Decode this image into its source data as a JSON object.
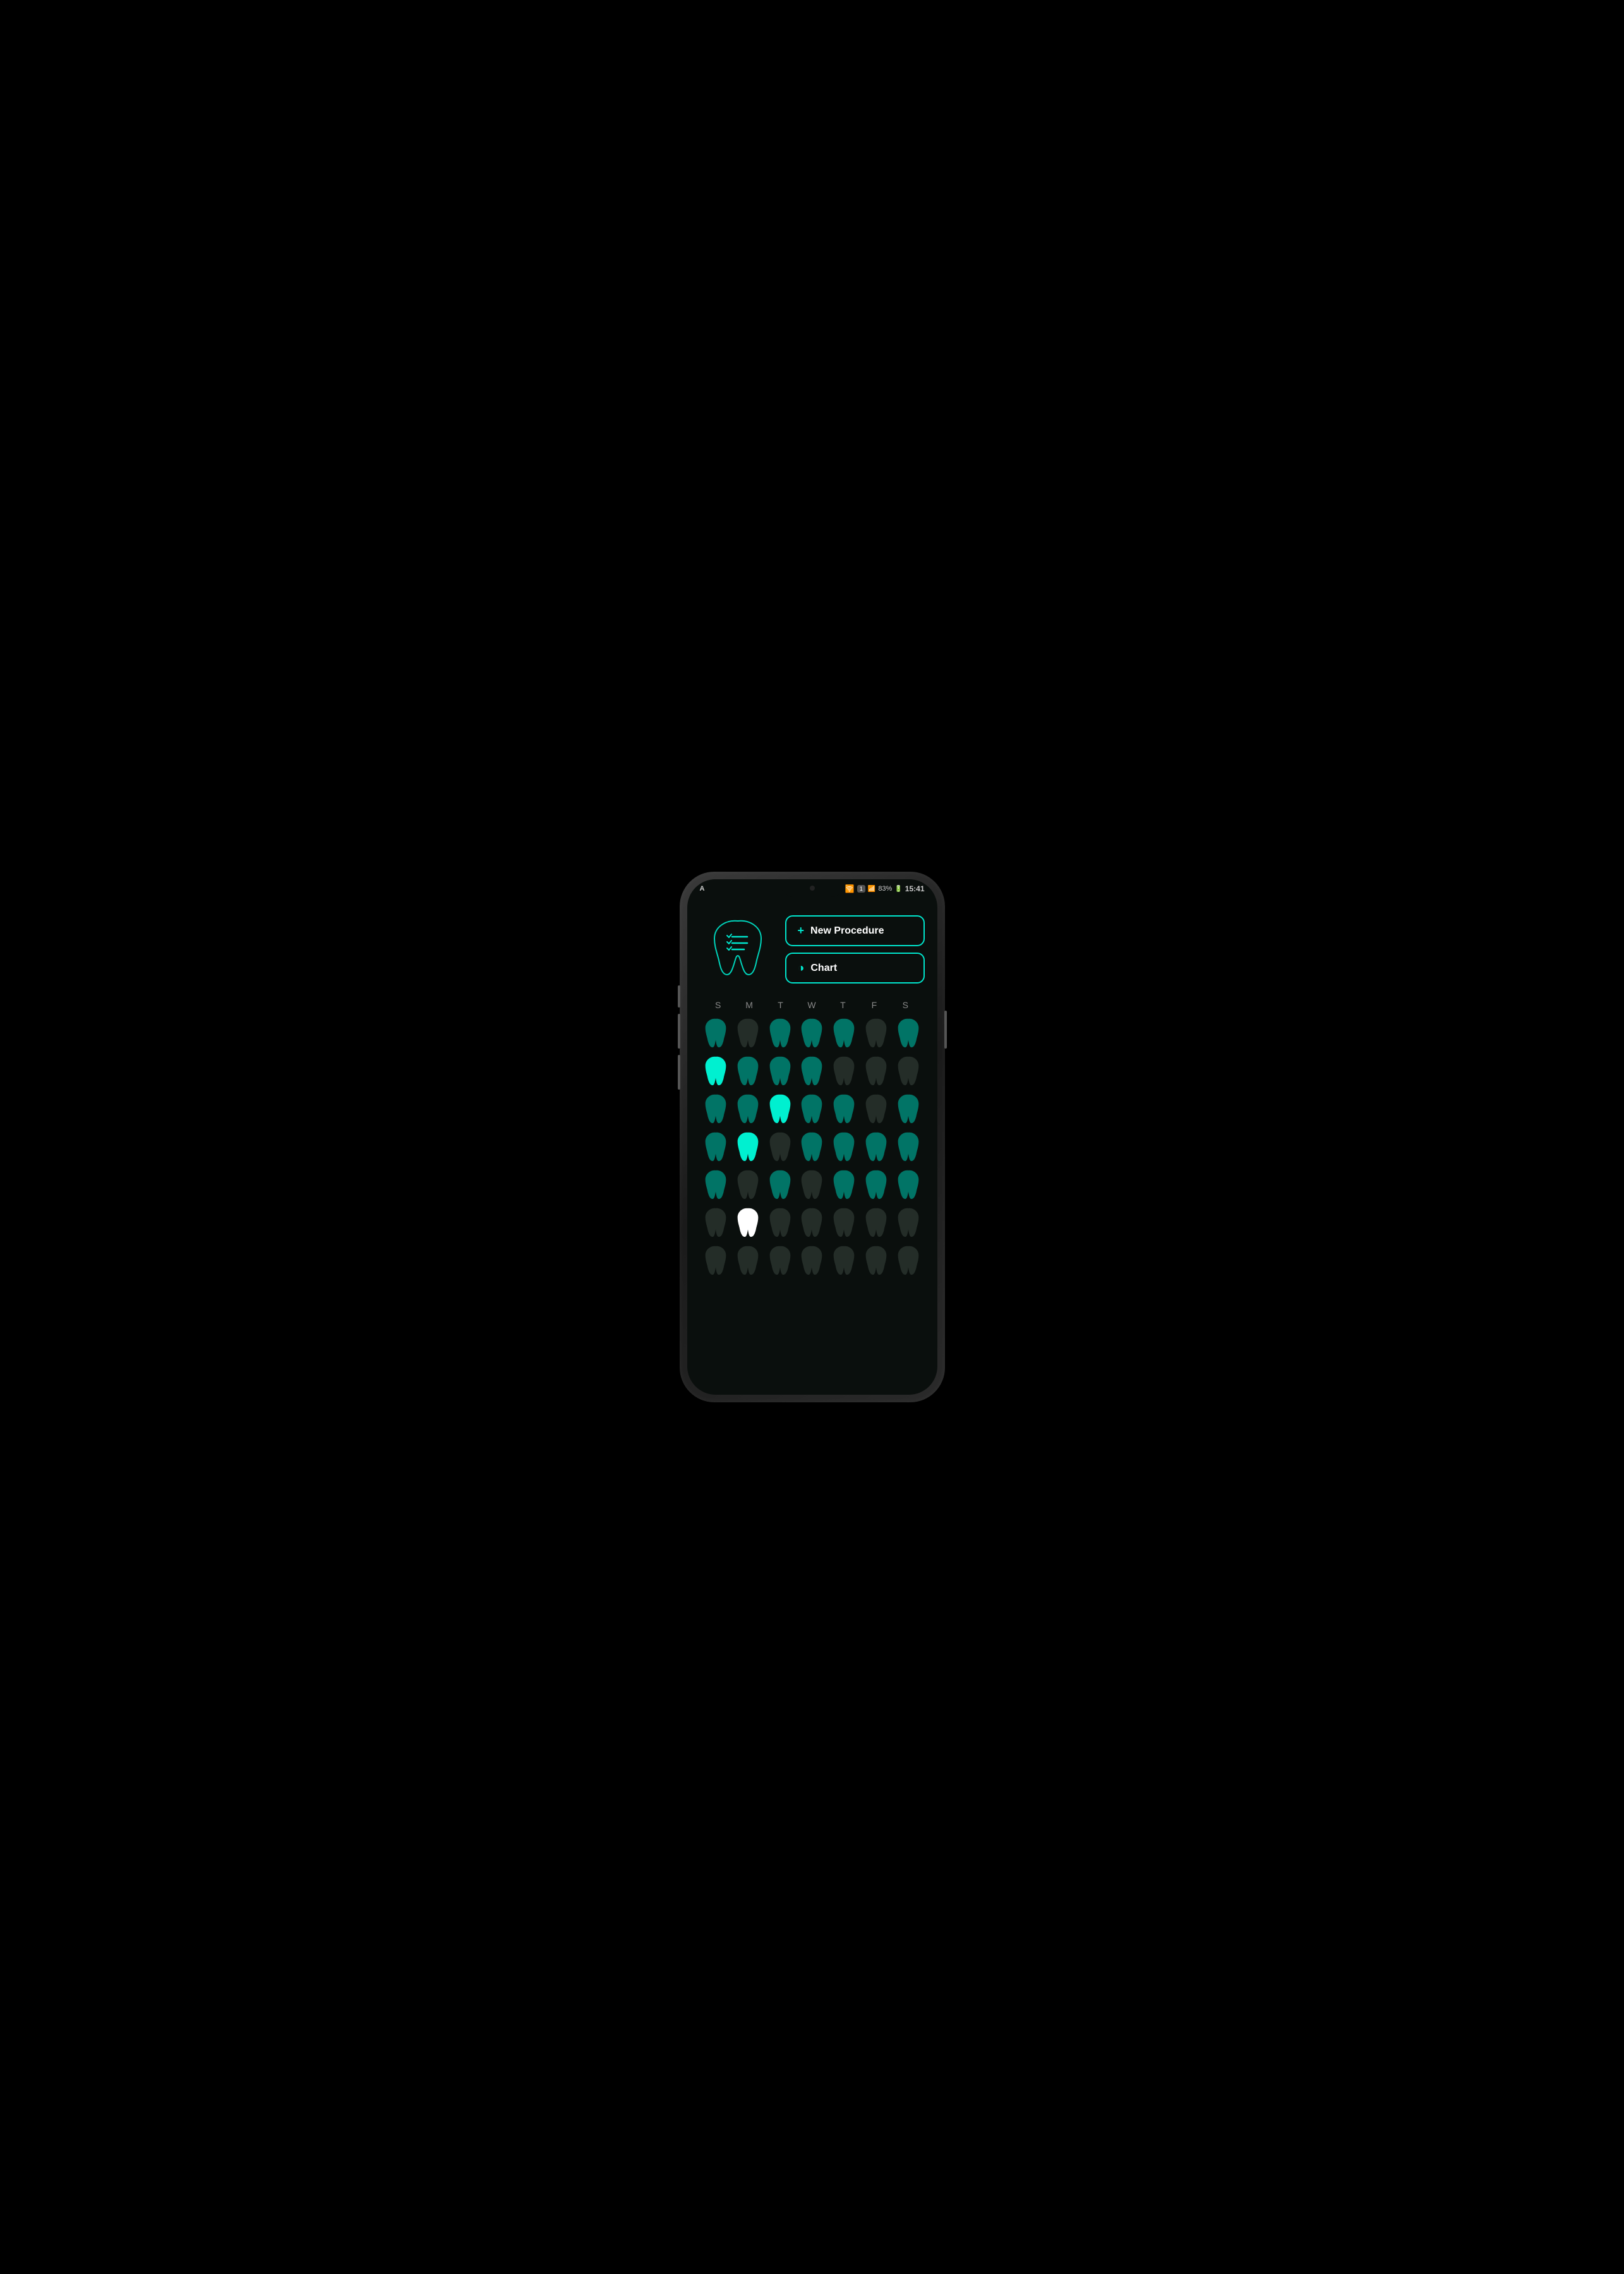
{
  "phone": {
    "status_bar": {
      "left_icon": "A",
      "time": "15:41",
      "battery": "83%",
      "signal": "1"
    },
    "header": {
      "new_procedure_label": "New Procedure",
      "new_procedure_icon": "+",
      "chart_label": "Chart",
      "chart_icon": "◑"
    },
    "calendar": {
      "day_labels": [
        "S",
        "M",
        "T",
        "W",
        "T",
        "F",
        "S"
      ],
      "rows": [
        [
          {
            "color": "teal",
            "brightness": "medium"
          },
          {
            "color": "dark"
          },
          {
            "color": "teal",
            "brightness": "medium"
          },
          {
            "color": "teal",
            "brightness": "medium"
          },
          {
            "color": "teal",
            "brightness": "medium"
          },
          {
            "color": "dark"
          },
          {
            "color": "teal",
            "brightness": "medium"
          }
        ],
        [
          {
            "color": "teal",
            "brightness": "bright"
          },
          {
            "color": "teal",
            "brightness": "medium"
          },
          {
            "color": "teal",
            "brightness": "medium"
          },
          {
            "color": "teal",
            "brightness": "medium"
          },
          {
            "color": "dark"
          },
          {
            "color": "dark"
          },
          {
            "color": "dark"
          }
        ],
        [
          {
            "color": "teal",
            "brightness": "medium"
          },
          {
            "color": "teal",
            "brightness": "medium"
          },
          {
            "color": "teal",
            "brightness": "bright"
          },
          {
            "color": "teal",
            "brightness": "medium"
          },
          {
            "color": "teal",
            "brightness": "medium"
          },
          {
            "color": "dark"
          },
          {
            "color": "teal",
            "brightness": "medium"
          }
        ],
        [
          {
            "color": "teal",
            "brightness": "medium"
          },
          {
            "color": "teal",
            "brightness": "bright"
          },
          {
            "color": "dark"
          },
          {
            "color": "teal",
            "brightness": "medium"
          },
          {
            "color": "teal",
            "brightness": "medium"
          },
          {
            "color": "teal",
            "brightness": "medium"
          },
          {
            "color": "teal",
            "brightness": "medium"
          }
        ],
        [
          {
            "color": "teal",
            "brightness": "medium"
          },
          {
            "color": "dark"
          },
          {
            "color": "teal",
            "brightness": "medium"
          },
          {
            "color": "dark"
          },
          {
            "color": "teal",
            "brightness": "medium"
          },
          {
            "color": "teal",
            "brightness": "medium"
          },
          {
            "color": "teal",
            "brightness": "medium"
          }
        ],
        [
          {
            "color": "dark"
          },
          {
            "color": "white"
          },
          {
            "color": "dark"
          },
          {
            "color": "dark"
          },
          {
            "color": "dark"
          },
          {
            "color": "dark"
          },
          {
            "color": "dark"
          }
        ],
        [
          {
            "color": "dark"
          },
          {
            "color": "dark"
          },
          {
            "color": "dark"
          },
          {
            "color": "dark"
          },
          {
            "color": "dark"
          },
          {
            "color": "dark"
          },
          {
            "color": "dark"
          }
        ]
      ]
    }
  }
}
